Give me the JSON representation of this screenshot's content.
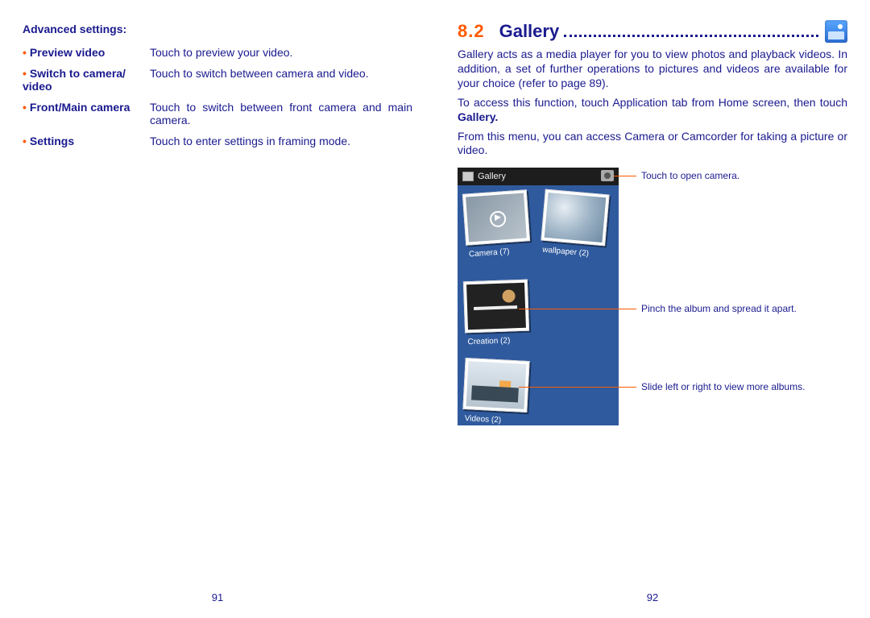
{
  "left": {
    "heading": "Advanced settings:",
    "rows": [
      {
        "label": "Preview video",
        "desc": "Touch to preview your video."
      },
      {
        "label": "Switch to camera/\nvideo",
        "desc": "Touch to switch between camera and video."
      },
      {
        "label": "Front/Main camera",
        "desc": "Touch to switch between front camera and main camera."
      },
      {
        "label": "Settings",
        "desc": "Touch to enter settings in framing mode."
      }
    ],
    "page_number": "91"
  },
  "right": {
    "section_number": "8.2",
    "section_title": "Gallery",
    "paras": {
      "p1": "Gallery acts as a media player for you to view photos and playback videos. In addition, a set of further operations to pictures and videos are available for your choice (refer to page 89).",
      "p2a": "To access this function, touch Application tab from Home screen, then touch ",
      "p2b": "Gallery.",
      "p3": "From this menu, you can access Camera or Camcorder for taking a picture or video."
    },
    "screenshot": {
      "header_label": "Gallery",
      "albums": {
        "a1": "Camera (7)",
        "a2": "wallpaper (2)",
        "a3": "Creation (2)",
        "a4": "Videos (2)"
      }
    },
    "callouts": {
      "c1": "Touch to open camera.",
      "c2": "Pinch the album and spread it apart.",
      "c3": "Slide left or right to view more albums."
    },
    "page_number": "92"
  }
}
